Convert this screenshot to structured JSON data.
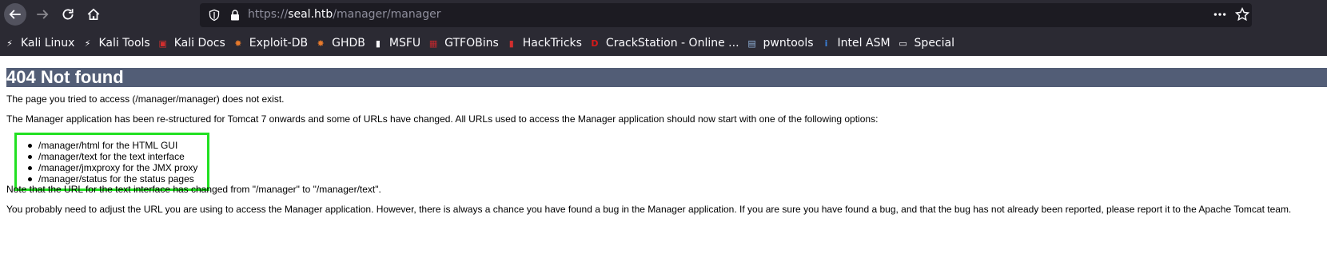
{
  "browser": {
    "url_prefix": "https://",
    "url_host": "seal.htb",
    "url_path": "/manager/manager",
    "bookmarks": [
      {
        "label": "Kali Linux",
        "icon": "kali-dragon-icon",
        "color": "#fbfbfe"
      },
      {
        "label": "Kali Tools",
        "icon": "kali-dragon-icon",
        "color": "#fbfbfe"
      },
      {
        "label": "Kali Docs",
        "icon": "kali-docs-icon",
        "color": "#d22e2e"
      },
      {
        "label": "Exploit-DB",
        "icon": "exploit-db-icon",
        "color": "#e87a2b"
      },
      {
        "label": "GHDB",
        "icon": "ghdb-icon",
        "color": "#e87a2b"
      },
      {
        "label": "MSFU",
        "icon": "msfu-icon",
        "color": "#fbfbfe"
      },
      {
        "label": "GTFOBins",
        "icon": "gtfobins-icon",
        "color": "#c0282d"
      },
      {
        "label": "HackTricks",
        "icon": "hacktricks-icon",
        "color": "#d22e2e"
      },
      {
        "label": "CrackStation - Online ...",
        "icon": "crackstation-icon",
        "color": "#d41a1a"
      },
      {
        "label": "pwntools",
        "icon": "pwntools-icon",
        "color": "#8fb0d8"
      },
      {
        "label": "Intel ASM",
        "icon": "intel-icon",
        "color": "#3a7ed6"
      },
      {
        "label": "Special",
        "icon": "folder-icon",
        "color": "#fbfbfe"
      }
    ]
  },
  "page": {
    "title": "404 Not found",
    "p1": "The page you tried to access (/manager/manager) does not exist.",
    "p2": "The Manager application has been re-structured for Tomcat 7 onwards and some of URLs have changed. All URLs used to access the Manager application should now start with one of the following options:",
    "options": [
      "/manager/html for the HTML GUI",
      "/manager/text for the text interface",
      "/manager/jmxproxy for the JMX proxy",
      "/manager/status for the status pages"
    ],
    "p3": "Note that the URL for the text interface has changed from \"/manager\" to \"/manager/text\".",
    "p4": "You probably need to adjust the URL you are using to access the Manager application. However, there is always a chance you have found a bug in the Manager application. If you are sure you have found a bug, and that the bug has not already been reported, please report it to the Apache Tomcat team."
  },
  "colors": {
    "heading_bg": "#525d76",
    "highlight_border": "#22e022",
    "chrome_bg": "#2b2a33"
  }
}
